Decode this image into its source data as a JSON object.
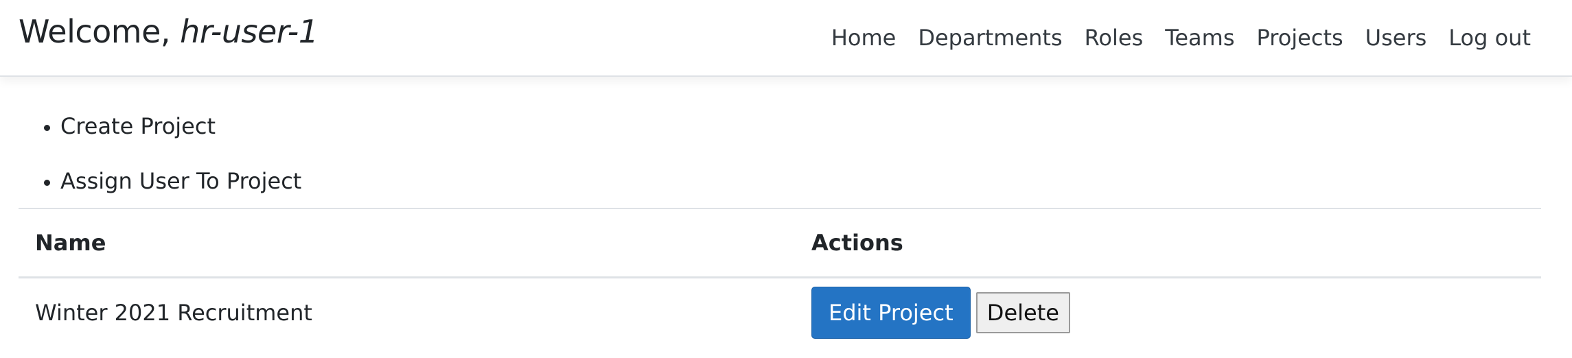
{
  "header": {
    "welcome_prefix": "Welcome, ",
    "username": "hr-user-1",
    "nav": [
      {
        "label": "Home"
      },
      {
        "label": "Departments"
      },
      {
        "label": "Roles"
      },
      {
        "label": "Teams"
      },
      {
        "label": "Projects"
      },
      {
        "label": "Users"
      },
      {
        "label": "Log out"
      }
    ]
  },
  "actions": [
    {
      "label": "Create Project"
    },
    {
      "label": "Assign User To Project"
    }
  ],
  "table": {
    "columns": [
      "Name",
      "Actions"
    ],
    "rows": [
      {
        "name": "Winter 2021 Recruitment",
        "edit_label": "Edit Project",
        "delete_label": "Delete"
      }
    ]
  },
  "colors": {
    "primary_button": "#2474c4",
    "text": "#212529"
  }
}
